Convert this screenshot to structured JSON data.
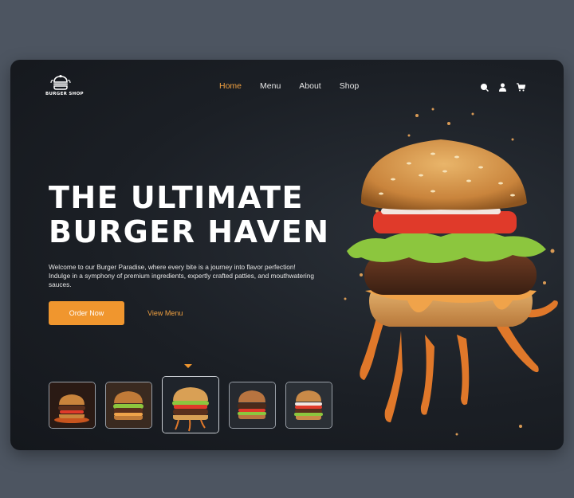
{
  "brand": {
    "logo_text": "BURGER SHOP"
  },
  "nav": {
    "items": [
      {
        "label": "Home",
        "active": true
      },
      {
        "label": "Menu",
        "active": false
      },
      {
        "label": "About",
        "active": false
      },
      {
        "label": "Shop",
        "active": false
      }
    ],
    "icons": [
      "search-icon",
      "user-icon",
      "cart-icon"
    ]
  },
  "hero": {
    "title": "THE ULTIMATE\nBURGER HAVEN",
    "description": "Welcome to our Burger Paradise, where every bite is a journey into flavor perfection! Indulge in a symphony of premium ingredients, expertly crafted patties, and mouthwatering sauces.",
    "primary_button": "Order Now",
    "secondary_button": "View Menu"
  },
  "thumbnails": {
    "count": 5,
    "selected": 3
  },
  "colors": {
    "accent": "#f0962e",
    "background": "#1b1f25",
    "page": "#4d5561"
  }
}
